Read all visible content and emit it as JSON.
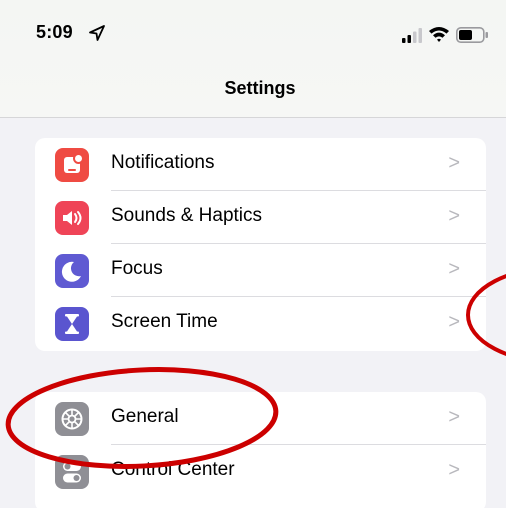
{
  "status_bar": {
    "time": "5:09",
    "icons": [
      "location-arrow-icon",
      "cellular-signal-icon",
      "wifi-icon",
      "battery-icon"
    ]
  },
  "nav": {
    "title": "Settings"
  },
  "groups": [
    {
      "items": [
        {
          "label": "Notifications",
          "icon": "notifications-icon",
          "color": "#ef4b43"
        },
        {
          "label": "Sounds & Haptics",
          "icon": "sounds-icon",
          "color": "#ef4457"
        },
        {
          "label": "Focus",
          "icon": "moon-icon",
          "color": "#5f5ad2"
        },
        {
          "label": "Screen Time",
          "icon": "hourglass-icon",
          "color": "#5a55cf"
        }
      ]
    },
    {
      "items": [
        {
          "label": "General",
          "icon": "gear-icon",
          "color": "#8f8f95"
        },
        {
          "label": "Control Center",
          "icon": "toggles-icon",
          "color": "#8f8f95"
        }
      ]
    }
  ],
  "chevron": ">",
  "annotation_color": "#cc0000"
}
